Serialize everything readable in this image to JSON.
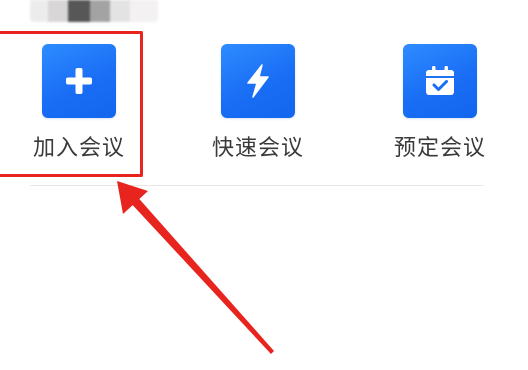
{
  "actions": {
    "join": {
      "label": "加入会议",
      "icon": "plus-icon"
    },
    "quick": {
      "label": "快速会议",
      "icon": "lightning-bolt-icon"
    },
    "schedule": {
      "label": "预定会议",
      "icon": "calendar-check-icon"
    }
  },
  "colors": {
    "icon_blue": "#1a6ef5",
    "annotation_red": "#e8241f",
    "label_text": "#3a3a3a",
    "divider": "#e8e8e8"
  }
}
